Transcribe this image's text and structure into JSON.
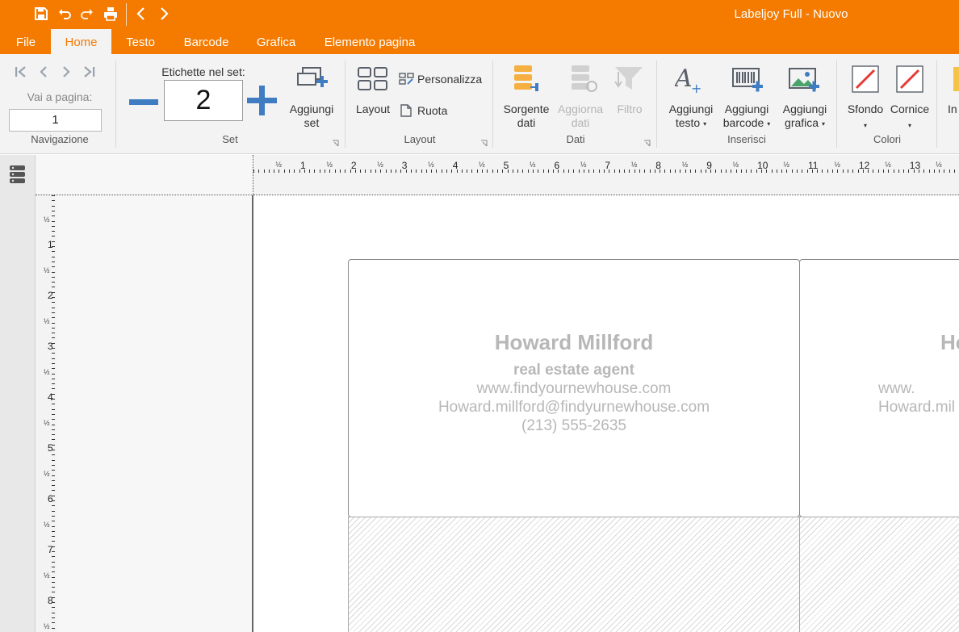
{
  "window": {
    "title": "Labeljoy Full - Nuovo"
  },
  "quick_access": {
    "icons": [
      "save-icon",
      "undo-icon",
      "redo-icon",
      "print-icon",
      "arrow-left-icon",
      "arrow-right-icon"
    ]
  },
  "menu": {
    "tabs": [
      "File",
      "Home",
      "Testo",
      "Barcode",
      "Grafica",
      "Elemento pagina"
    ],
    "active": "Home"
  },
  "ribbon": {
    "navigation": {
      "goto_label": "Vai a pagina:",
      "page_value": "1",
      "group_label": "Navigazione"
    },
    "set": {
      "count_label": "Etichette nel set:",
      "count_value": "2",
      "add_set_label": "Aggiungi set",
      "group_label": "Set"
    },
    "layout": {
      "layout_label": "Layout",
      "customize_label": "Personalizza",
      "rotate_label": "Ruota",
      "group_label": "Layout"
    },
    "data": {
      "source_label": "Sorgente dati",
      "refresh_label": "Aggiorna dati",
      "filter_label": "Filtro",
      "group_label": "Dati"
    },
    "insert": {
      "add_text_label": "Aggiungi testo",
      "add_barcode_label": "Aggiungi barcode",
      "add_graphic_label": "Aggiungi grafica",
      "group_label": "Inserisci"
    },
    "colors": {
      "background_label": "Sfondo",
      "border_label": "Cornice",
      "group_label": "Colori"
    },
    "extra": {
      "label": "In"
    }
  },
  "rulers": {
    "horizontal_numbers": [
      "1",
      "2",
      "3",
      "4",
      "5",
      "6",
      "7",
      "8",
      "9",
      "10",
      "11",
      "12",
      "13"
    ],
    "vertical_numbers": [
      "1",
      "2",
      "3",
      "4",
      "5",
      "6",
      "7",
      "8"
    ],
    "half_mark": "½"
  },
  "labels": [
    {
      "name": "Howard Millford",
      "job": "real estate agent",
      "website": "www.findyournewhouse.com",
      "email": "Howard.millford@findyurnewhouse.com",
      "phone": "(213) 555-2635"
    },
    {
      "name": "Ho",
      "job": "",
      "website": "www.",
      "email": "Howard.mil",
      "phone": ""
    }
  ],
  "colors": {
    "accent": "#f47a00",
    "ribbon_bg": "#f3f3f3",
    "label_text": "#b7b7b7"
  }
}
